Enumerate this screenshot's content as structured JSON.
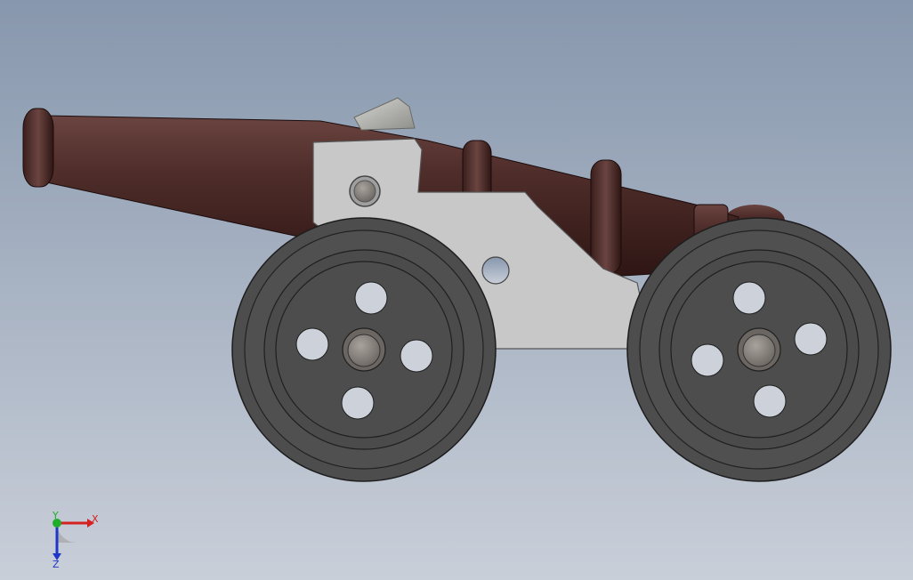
{
  "viewport": {
    "background": {
      "top_color": "#8797ad",
      "bottom_color": "#c9cfd9"
    }
  },
  "model": {
    "barrel_color": "#4a2a27",
    "carriage_color": "#c8c8c8",
    "wheel_color": "#4d4d4d",
    "hub_color": "#8a8580",
    "vent_color": "#a9a9a6"
  },
  "triad": {
    "x_label": "X",
    "y_label": "Y",
    "z_label": "Z",
    "x_color": "#d42020",
    "y_color": "#1fae2c",
    "z_color": "#2036c8"
  }
}
